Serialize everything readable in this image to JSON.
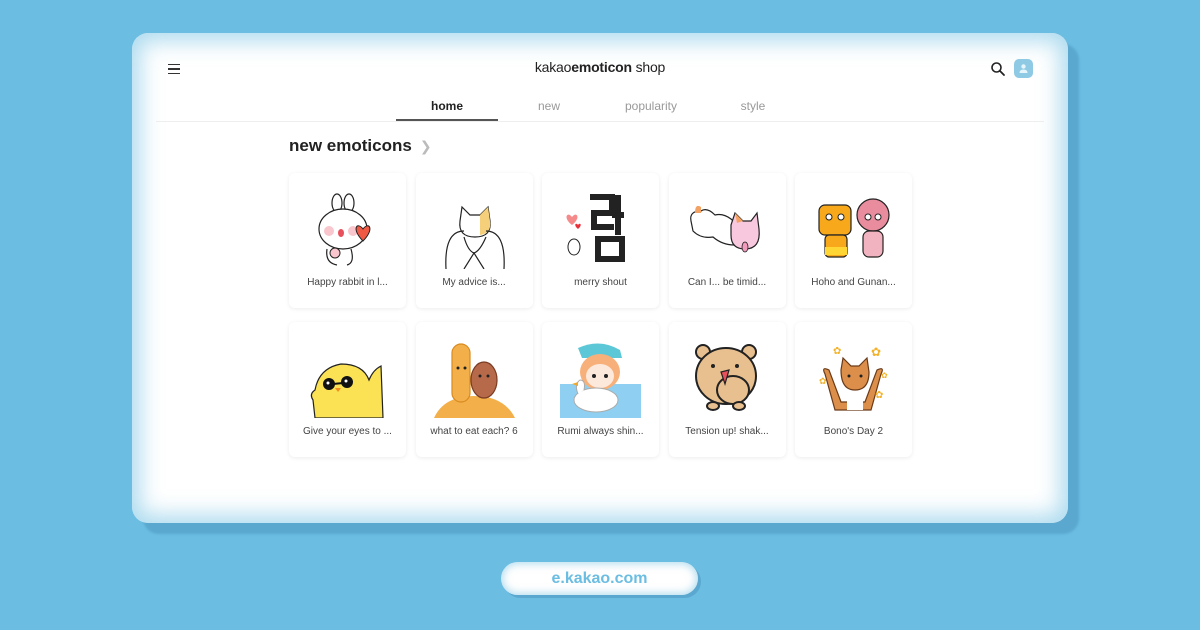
{
  "header": {
    "brand_prefix": "kakao",
    "brand_bold": "emoticon",
    "brand_suffix": " shop",
    "menu_icon": "hamburger-menu-icon",
    "search_icon": "search-icon",
    "profile_icon": "user-profile-icon"
  },
  "tabs": [
    {
      "label": "home",
      "active": true
    },
    {
      "label": "new",
      "active": false
    },
    {
      "label": "popularity",
      "active": false
    },
    {
      "label": "style",
      "active": false
    }
  ],
  "section": {
    "title": "new emoticons",
    "more_icon": "chevron-right-icon"
  },
  "emoticons": [
    {
      "title": "Happy rabbit in l...",
      "image": "white rabbit holding red heart"
    },
    {
      "title": "My advice is...",
      "image": "white and yellow cat hugging"
    },
    {
      "title": "merry shout",
      "image": "black korean brush text with hearts"
    },
    {
      "title": "Can I... be timid...",
      "image": "pink cat lying down"
    },
    {
      "title": "Hoho and Gunan...",
      "image": "orange and pink characters"
    },
    {
      "title": "Give your eyes to ...",
      "image": "yellow chick with sunglasses"
    },
    {
      "title": "what to eat each? 6",
      "image": "fried food characters"
    },
    {
      "title": "Rumi always shin...",
      "image": "girl with swan float in water"
    },
    {
      "title": "Tension up! shak...",
      "image": "brown hamster dancing"
    },
    {
      "title": "Bono's Day 2",
      "image": "orange tabby cat with stars"
    }
  ],
  "footer": {
    "url": "e.kakao.com"
  },
  "colors": {
    "background": "#6bbde2",
    "frame_shadow": "#5aa8cf",
    "accent": "#8fcae5"
  }
}
